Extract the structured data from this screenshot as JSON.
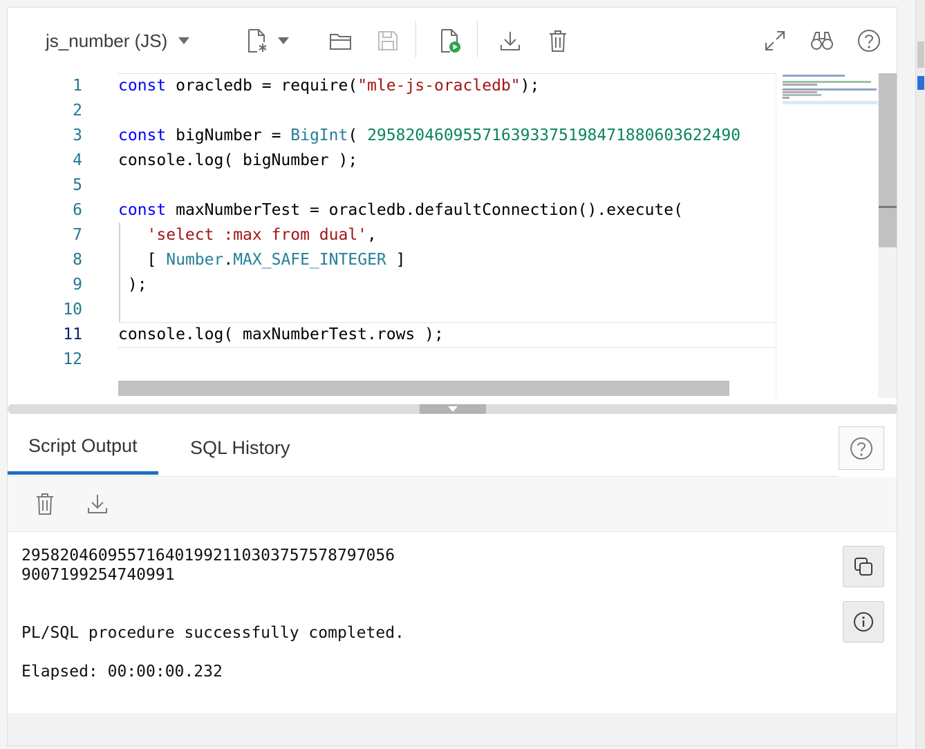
{
  "toolbar": {
    "document_name": "js_number (JS)",
    "buttons": [
      "new-file-icon",
      "open-folder-icon",
      "save-icon",
      "run-script-icon",
      "download-icon",
      "trash-icon",
      "expand-icon",
      "binoculars-icon",
      "help-icon"
    ]
  },
  "editor": {
    "line_numbers": [
      "1",
      "2",
      "3",
      "4",
      "5",
      "6",
      "7",
      "8",
      "9",
      "10",
      "11",
      "12"
    ],
    "active_line": "11",
    "lines": {
      "l1": {
        "kw": "const",
        "t1": " oracledb = require(",
        "s1": "\"mle-js-oracledb\"",
        "t2": ");"
      },
      "l3": {
        "kw": "const",
        "t1": " bigNumber = ",
        "ty": "BigInt",
        "t2": "( ",
        "n1": "295820460955716393375198471880603622490"
      },
      "l4": {
        "t1": "console.log( bigNumber );"
      },
      "l6": {
        "kw": "const",
        "t1": " maxNumberTest = oracledb.defaultConnection().execute("
      },
      "l7": {
        "pre": "   ",
        "s1": "'select :max from dual'",
        "t1": ","
      },
      "l8": {
        "pre": "   ",
        "t1": "[ ",
        "ty": "Number",
        "t2": ".",
        "ty2": "MAX_SAFE_INTEGER",
        "t3": " ]"
      },
      "l9": {
        "t1": " );"
      },
      "l11": {
        "t1": "console.log( maxNumberTest.rows );"
      }
    }
  },
  "output": {
    "tabs": [
      "Script Output",
      "SQL History"
    ],
    "active_tab": "Script Output",
    "lines": [
      "295820460955716401992110303757578797056",
      "9007199254740991",
      "PL/SQL procedure successfully completed.",
      "Elapsed: 00:00:00.232"
    ]
  },
  "colors": {
    "keyword": "#0000ff",
    "string": "#a31515",
    "number": "#098658",
    "type": "#267f99",
    "line_number": "#237893",
    "tab_underline": "#1e6fc2",
    "run_green": "#2ea44f"
  }
}
